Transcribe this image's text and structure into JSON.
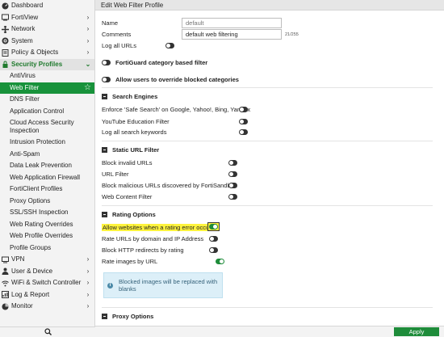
{
  "sidebar": {
    "top_items": [
      {
        "label": "Dashboard",
        "icon": "dashboard-icon",
        "chevron": false
      },
      {
        "label": "FortiView",
        "icon": "fortiview-icon",
        "chevron": true
      },
      {
        "label": "Network",
        "icon": "network-icon",
        "chevron": true
      },
      {
        "label": "System",
        "icon": "gear-icon",
        "chevron": true
      },
      {
        "label": "Policy & Objects",
        "icon": "policy-icon",
        "chevron": true
      },
      {
        "label": "Security Profiles",
        "icon": "lock-icon",
        "chevron": true
      }
    ],
    "security_sub": [
      {
        "label": "AntiVirus"
      },
      {
        "label": "Web Filter"
      },
      {
        "label": "DNS Filter"
      },
      {
        "label": "Application Control"
      },
      {
        "label": "Cloud Access Security Inspection"
      },
      {
        "label": "Intrusion Protection"
      },
      {
        "label": "Anti-Spam"
      },
      {
        "label": "Data Leak Prevention"
      },
      {
        "label": "Web Application Firewall"
      },
      {
        "label": "FortiClient Profiles"
      },
      {
        "label": "Proxy Options"
      },
      {
        "label": "SSL/SSH Inspection"
      },
      {
        "label": "Web Rating Overrides"
      },
      {
        "label": "Web Profile Overrides"
      },
      {
        "label": "Profile Groups"
      }
    ],
    "bottom_items": [
      {
        "label": "VPN",
        "icon": "monitor-icon"
      },
      {
        "label": "User & Device",
        "icon": "user-icon"
      },
      {
        "label": "WiFi & Switch Controller",
        "icon": "wifi-icon"
      },
      {
        "label": "Log & Report",
        "icon": "chart-icon"
      },
      {
        "label": "Monitor",
        "icon": "pie-icon"
      }
    ]
  },
  "main": {
    "header": "Edit Web Filter Profile",
    "name_label": "Name",
    "name_placeholder": "default",
    "comments_label": "Comments",
    "comments_value": "default web filtering",
    "comments_count": "21/255",
    "log_all_urls": "Log all URLs",
    "fortiguard": "FortiGuard category based filter",
    "allow_override": "Allow users to override blocked categories",
    "search_engines": {
      "title": "Search Engines",
      "options": [
        {
          "label": "Enforce 'Safe Search' on Google, Yahoo!, Bing, Yandex",
          "on": false
        },
        {
          "label": "YouTube Education Filter",
          "on": false
        },
        {
          "label": "Log all search keywords",
          "on": false
        }
      ]
    },
    "static_url": {
      "title": "Static URL Filter",
      "options": [
        {
          "label": "Block invalid URLs",
          "on": false
        },
        {
          "label": "URL Filter",
          "on": false
        },
        {
          "label": "Block malicious URLs discovered by FortiSandbox",
          "on": false
        },
        {
          "label": "Web Content Filter",
          "on": false
        }
      ]
    },
    "rating": {
      "title": "Rating Options",
      "options": [
        {
          "label": "Allow websites when a rating error occurs",
          "on": true
        },
        {
          "label": "Rate URLs by domain and IP Address",
          "on": false
        },
        {
          "label": "Block HTTP redirects by rating",
          "on": false
        },
        {
          "label": "Rate images by URL",
          "on": true
        }
      ],
      "info": "Blocked images will be replaced with blanks"
    },
    "proxy_title": "Proxy Options",
    "apply": "Apply"
  },
  "colors": {
    "accent_green": "#1e8c3a",
    "highlight_yellow": "#fff33d",
    "info_blue": "#dceff8"
  }
}
